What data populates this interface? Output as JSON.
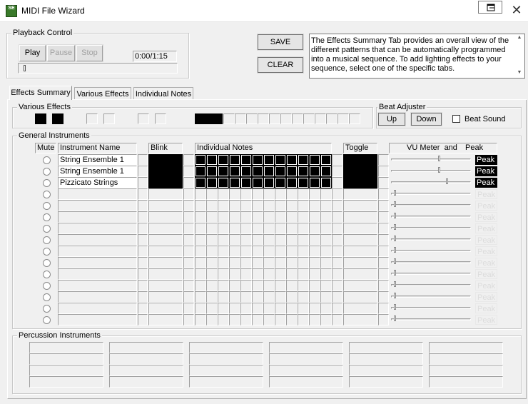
{
  "window": {
    "title": "MIDI File Wizard",
    "icon_text": "SE"
  },
  "playback": {
    "legend": "Playback Control",
    "play_label": "Play",
    "pause_label": "Pause",
    "stop_label": "Stop",
    "time": "0:00/1:15",
    "position": 0.0
  },
  "actions": {
    "save_label": "SAVE",
    "clear_label": "CLEAR"
  },
  "info_text": "The Effects Summary Tab provides an overall view of the different patterns that can be automatically programmed into a musical sequence. To add lighting effects to your sequence, select one of the specific tabs.",
  "tabs": [
    "Effects Summary",
    "Various Effects",
    "Individual Notes"
  ],
  "active_tab": "Effects Summary",
  "various_effects": {
    "legend": "Various Effects"
  },
  "beat_adjuster": {
    "legend": "Beat Adjuster",
    "up_label": "Up",
    "down_label": "Down",
    "beat_sound_label": "Beat Sound",
    "beat_sound_checked": false
  },
  "general": {
    "legend": "General Instruments",
    "headers": {
      "mute": "Mute",
      "instrument": "Instrument Name",
      "blink": "Blink",
      "notes": "Individual Notes",
      "toggle": "Toggle",
      "vu": "VU Meter  and",
      "peak": "Peak"
    },
    "instruments": [
      "String Ensemble 1",
      "String Ensemble 1",
      "Pizzicato Strings",
      "",
      "",
      "",
      "",
      "",
      "",
      "",
      "",
      "",
      "",
      "",
      ""
    ],
    "peak_label": "Peak",
    "active_rows": 3,
    "vu_levels": [
      0.55,
      0.55,
      0.65,
      0,
      0,
      0,
      0,
      0,
      0,
      0,
      0,
      0,
      0,
      0,
      0
    ]
  },
  "percussion": {
    "legend": "Percussion Instruments"
  },
  "icons": {
    "close": "close-icon",
    "restore": "restore-icon",
    "app": "app-icon",
    "scroll_up": "scroll-up-icon",
    "scroll_down": "scroll-down-icon"
  },
  "colors": {
    "active_cell": "#000000",
    "window_bg": "#f0f0f0"
  }
}
